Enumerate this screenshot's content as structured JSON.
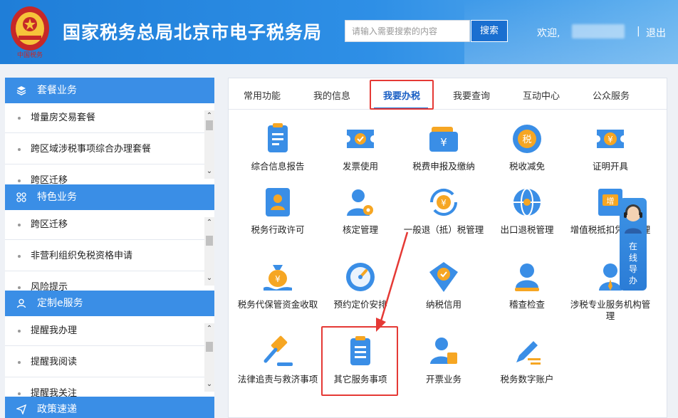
{
  "header": {
    "site_title": "国家税务总局北京市电子税务局",
    "search_placeholder": "请输入需要搜索的内容",
    "search_button": "搜索",
    "welcome": "欢迎,",
    "separator": "|",
    "logout": "退出",
    "emblem_icon": "tax-emblem-icon",
    "background_color": "#1f7ed8"
  },
  "sidebar": {
    "sections": [
      {
        "title": "套餐业务",
        "icon": "layers-icon",
        "items": [
          "增量房交易套餐",
          "跨区域涉税事项综合办理套餐",
          "跨区迁移"
        ]
      },
      {
        "title": "特色业务",
        "icon": "grid-icon",
        "items": [
          "跨区迁移",
          "非营利组织免税资格申请",
          "风险提示"
        ]
      },
      {
        "title": "定制e服务",
        "icon": "user-icon",
        "items": [
          "提醒我办理",
          "提醒我阅读",
          "提醒我关注"
        ]
      },
      {
        "title": "政策速递",
        "icon": "send-icon",
        "items": []
      }
    ]
  },
  "tabs": {
    "items": [
      "常用功能",
      "我的信息",
      "我要办税",
      "我要查询",
      "互动中心",
      "公众服务"
    ],
    "active_index": 2
  },
  "services": {
    "items": [
      {
        "label": "综合信息报告",
        "icon": "report-icon"
      },
      {
        "label": "发票使用",
        "icon": "invoice-icon"
      },
      {
        "label": "税费申报及缴纳",
        "icon": "wallet-yuan-icon"
      },
      {
        "label": "税收减免",
        "icon": "tax-reduction-icon"
      },
      {
        "label": "证明开具",
        "icon": "certificate-icon"
      },
      {
        "label": "税务行政许可",
        "icon": "id-card-icon"
      },
      {
        "label": "核定管理",
        "icon": "user-settings-icon"
      },
      {
        "label": "一般退（抵）税管理",
        "icon": "refund-icon"
      },
      {
        "label": "出口退税管理",
        "icon": "globe-icon"
      },
      {
        "label": "增值税抵扣凭证管理",
        "icon": "vat-icon"
      },
      {
        "label": "税务代保管资金收取",
        "icon": "money-bag-icon"
      },
      {
        "label": "预约定价安排",
        "icon": "gauge-icon"
      },
      {
        "label": "纳税信用",
        "icon": "diamond-check-icon"
      },
      {
        "label": "稽查检查",
        "icon": "inspector-icon"
      },
      {
        "label": "涉税专业服务机构管理",
        "icon": "agency-icon"
      },
      {
        "label": "法律追责与救济事项",
        "icon": "gavel-icon"
      },
      {
        "label": "其它服务事项",
        "icon": "clipboard-icon"
      },
      {
        "label": "开票业务",
        "icon": "billing-user-icon"
      },
      {
        "label": "税务数字账户",
        "icon": "pen-icon"
      }
    ],
    "highlighted": "其它服务事项"
  },
  "float_widget": {
    "text": "在线导办",
    "icon": "support-agent-icon"
  },
  "colors": {
    "accent": "#1a6fd0",
    "sidebar_head": "#3a8ee6",
    "highlight": "#e53935"
  }
}
